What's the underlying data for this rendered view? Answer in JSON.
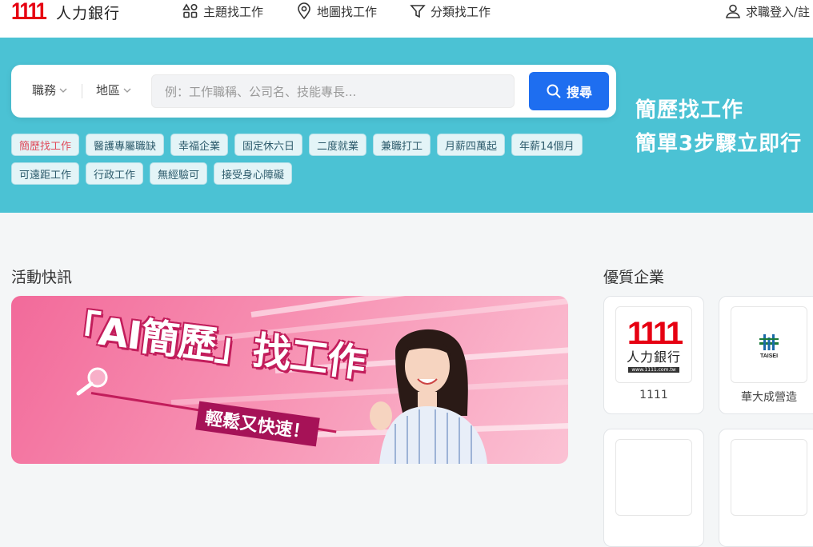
{
  "logo": {
    "number": "1111",
    "text": "人力銀行"
  },
  "nav": {
    "items": [
      {
        "label": "主題找工作",
        "icon": "topics-icon"
      },
      {
        "label": "地圖找工作",
        "icon": "map-pin-icon"
      },
      {
        "label": "分類找工作",
        "icon": "filter-icon"
      }
    ],
    "login": "求職登入/註"
  },
  "search": {
    "dropdown_job": "職務",
    "dropdown_area": "地區",
    "placeholder": "例：工作職稱、公司名、技能專長...",
    "button": "搜尋"
  },
  "tags": [
    "簡歷找工作",
    "醫護專屬職缺",
    "幸福企業",
    "固定休六日",
    "二度就業",
    "兼職打工",
    "月薪四萬起",
    "年薪14個月",
    "可遠距工作",
    "行政工作",
    "無經驗可",
    "接受身心障礙"
  ],
  "promo": {
    "line1": "簡歷找工作",
    "line2": "簡單3步驟立即行"
  },
  "activity": {
    "title": "活動快訊",
    "banner_title": "「AI簡歷」找工作",
    "banner_sub": "輕鬆又快速！"
  },
  "companies": {
    "title": "優質企業",
    "items": [
      {
        "name": "1111",
        "logo_main": "1111",
        "logo_sub": "人力銀行",
        "logo_url": "www.1111.com.tw"
      },
      {
        "name": "華大成營造",
        "logo_main": "TAISEI"
      }
    ]
  },
  "colors": {
    "hero": "#4bc2d4",
    "accent": "#1e6ef0",
    "brand_red": "#e60012"
  }
}
